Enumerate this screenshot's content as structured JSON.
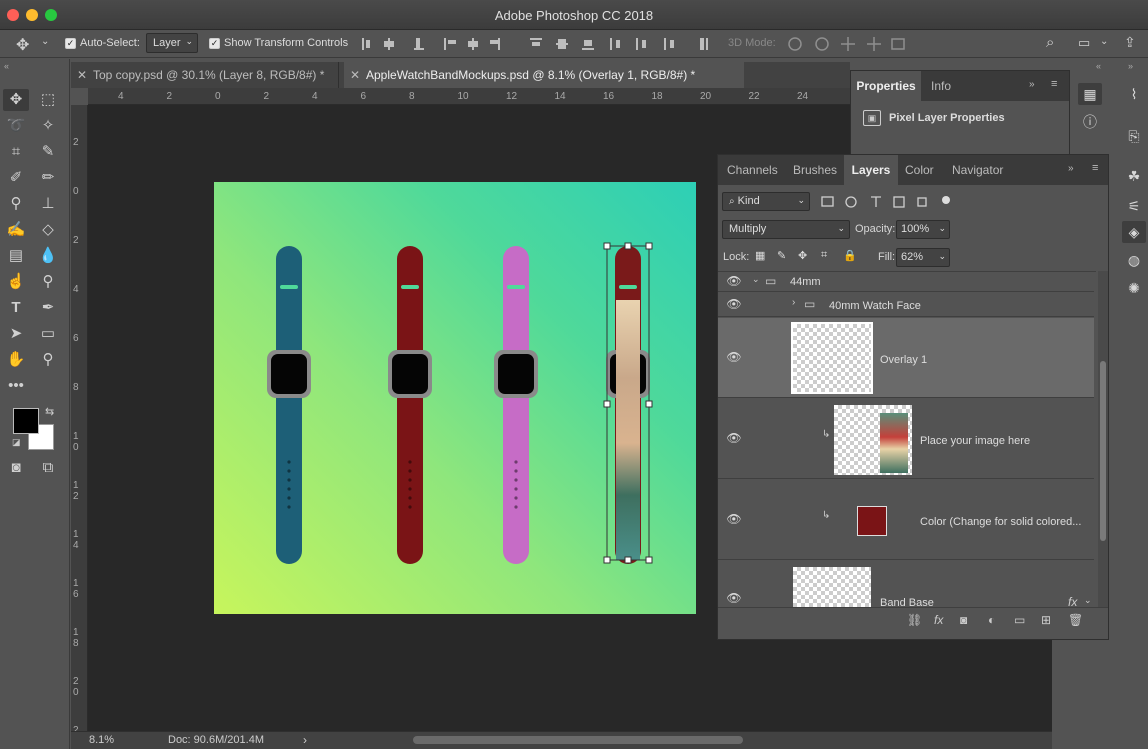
{
  "window": {
    "title": "Adobe Photoshop CC 2018"
  },
  "options_bar": {
    "auto_select_label": "Auto-Select:",
    "auto_select_value": "Layer",
    "transform_label": "Show Transform Controls",
    "mode_3d_label": "3D Mode:"
  },
  "doc_tabs": [
    {
      "label": "Top copy.psd @ 30.1% (Layer 8, RGB/8#) *"
    },
    {
      "label": "AppleWatchBandMockups.psd @ 8.1% (Overlay 1, RGB/8#) *"
    }
  ],
  "ruler_top": [
    "4",
    "2",
    "0",
    "2",
    "4",
    "6",
    "8",
    "10",
    "12",
    "14",
    "16",
    "18",
    "20",
    "22",
    "24"
  ],
  "ruler_left": [
    "2",
    "0",
    "2",
    "4",
    "6",
    "8",
    "1 0",
    "1 2",
    "1 4",
    "1 6",
    "1 8",
    "2 0",
    "2"
  ],
  "status": {
    "zoom": "8.1%",
    "doc": "Doc: 90.6M/201.4M"
  },
  "properties": {
    "tabs": [
      "Properties",
      "Info"
    ],
    "title": "Pixel Layer Properties"
  },
  "layers_panel": {
    "tabs": [
      "Channels",
      "Brushes",
      "Layers",
      "Color",
      "Navigator"
    ],
    "filter": "Kind",
    "blend_mode": "Multiply",
    "opacity_label": "Opacity:",
    "opacity_value": "100%",
    "lock_label": "Lock:",
    "fill_label": "Fill:",
    "fill_value": "62%",
    "layers": [
      {
        "name": "44mm"
      },
      {
        "name": "40mm Watch Face"
      },
      {
        "name": "Overlay 1"
      },
      {
        "name": "Place your image here"
      },
      {
        "name": "Color (Change for solid colored..."
      },
      {
        "name": "Band Base"
      }
    ]
  },
  "bands": [
    {
      "color": "#1d5f77"
    },
    {
      "color": "#7a1416"
    },
    {
      "color": "#c66cc6"
    },
    {
      "color": "#7a1a1a"
    }
  ],
  "colors": {
    "accent": "#4fd99a",
    "panel": "#535353",
    "canvas": "#282828"
  }
}
